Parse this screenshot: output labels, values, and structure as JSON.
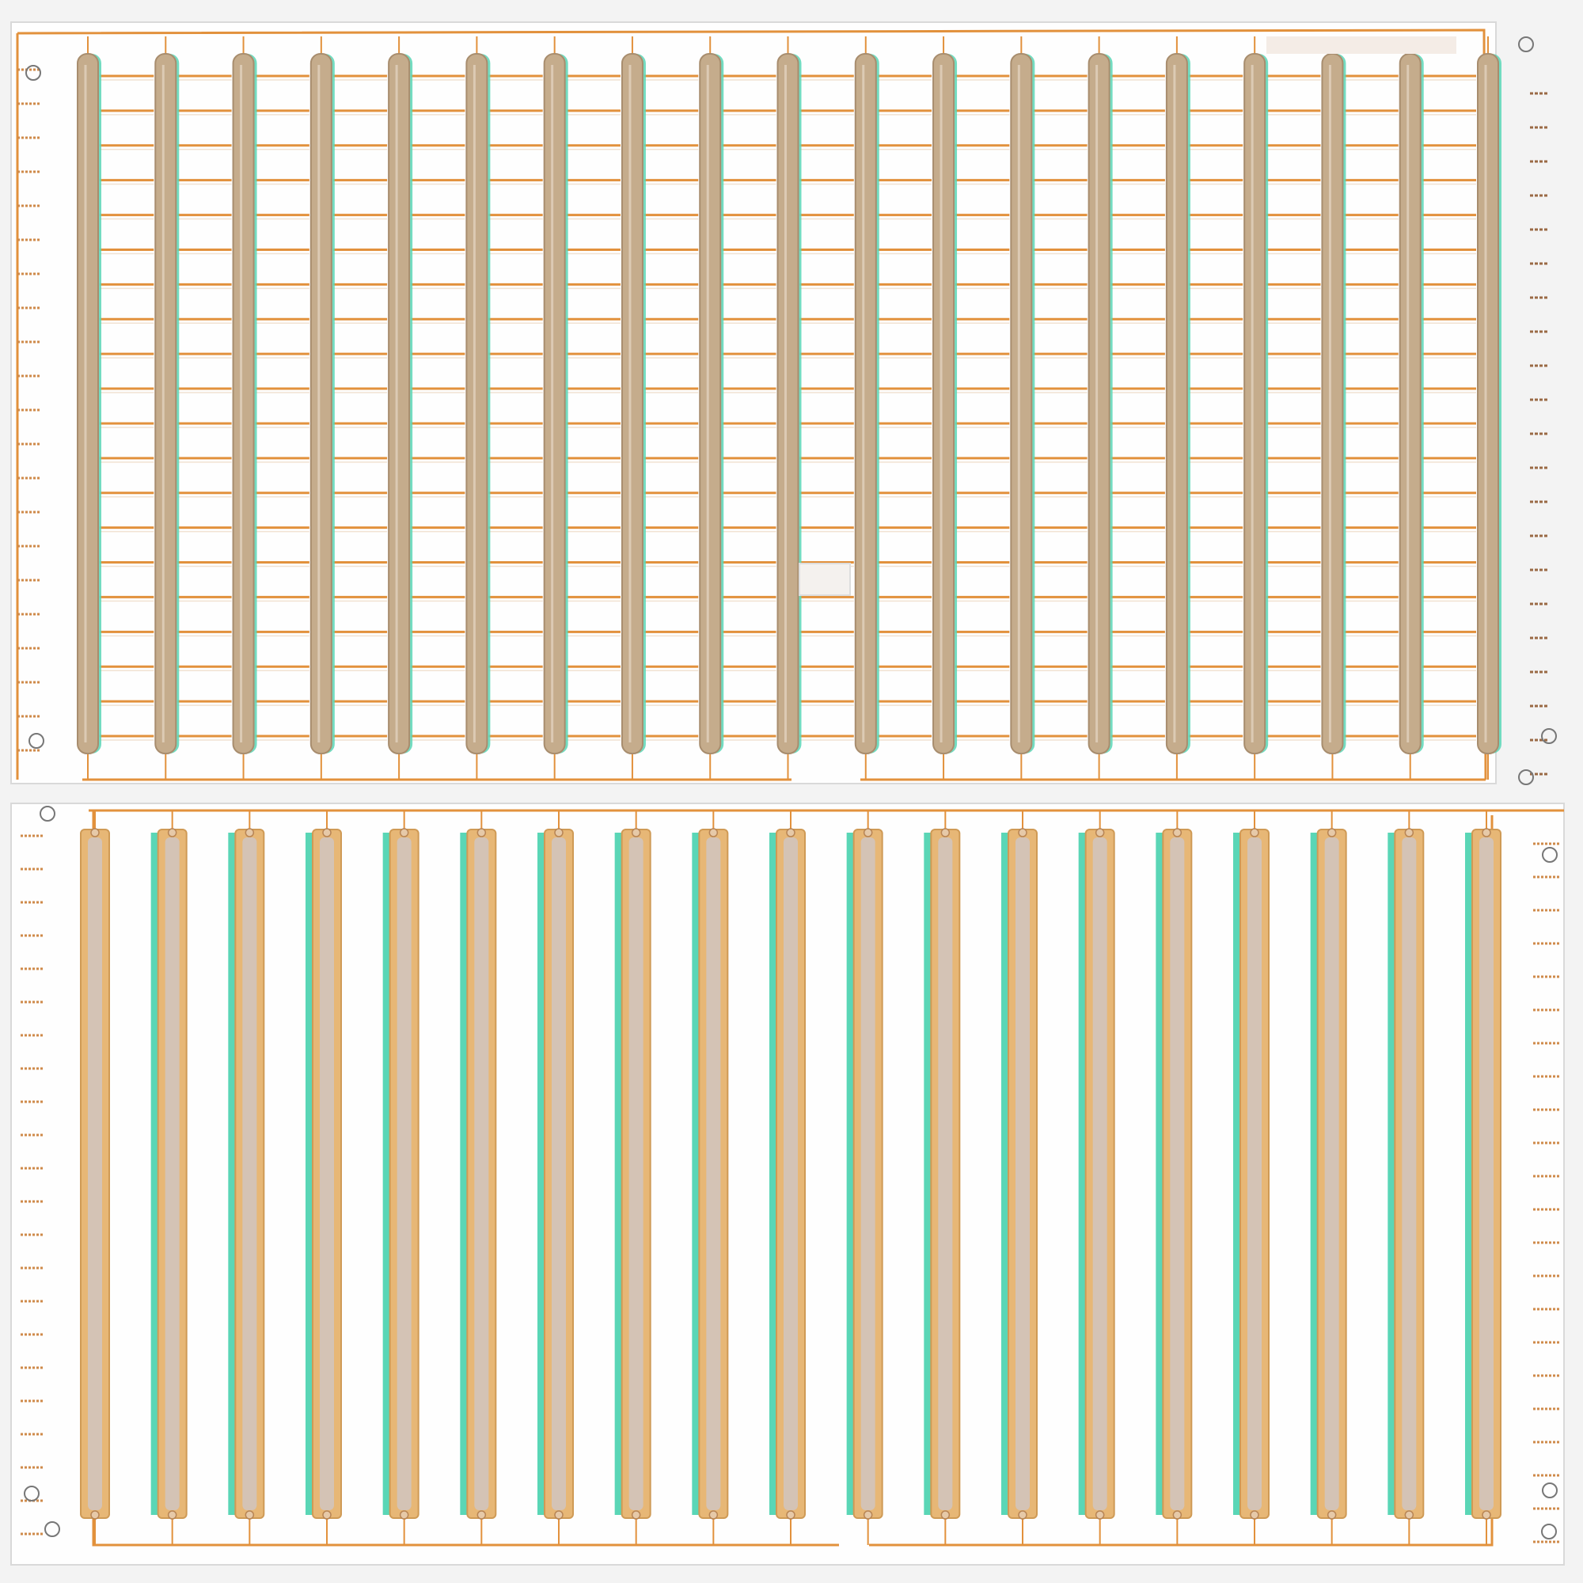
{
  "panels": [
    {
      "id": "top",
      "bar_count": 19,
      "style": "rods-with-rungs",
      "rung_rows": 20
    },
    {
      "id": "bottom",
      "bar_count": 19,
      "style": "strips-with-teal-edge"
    }
  ],
  "colors": {
    "background": "#f3f3f3",
    "board": "#fefefe",
    "copper": "#e2913c",
    "rod": "#c5ac8c",
    "rod_dark": "#a88d6e",
    "strip": "#e7b776",
    "strip_inner": "#d4c3b5",
    "teal": "#5ad6b6",
    "tick": "#cf8a4a"
  }
}
